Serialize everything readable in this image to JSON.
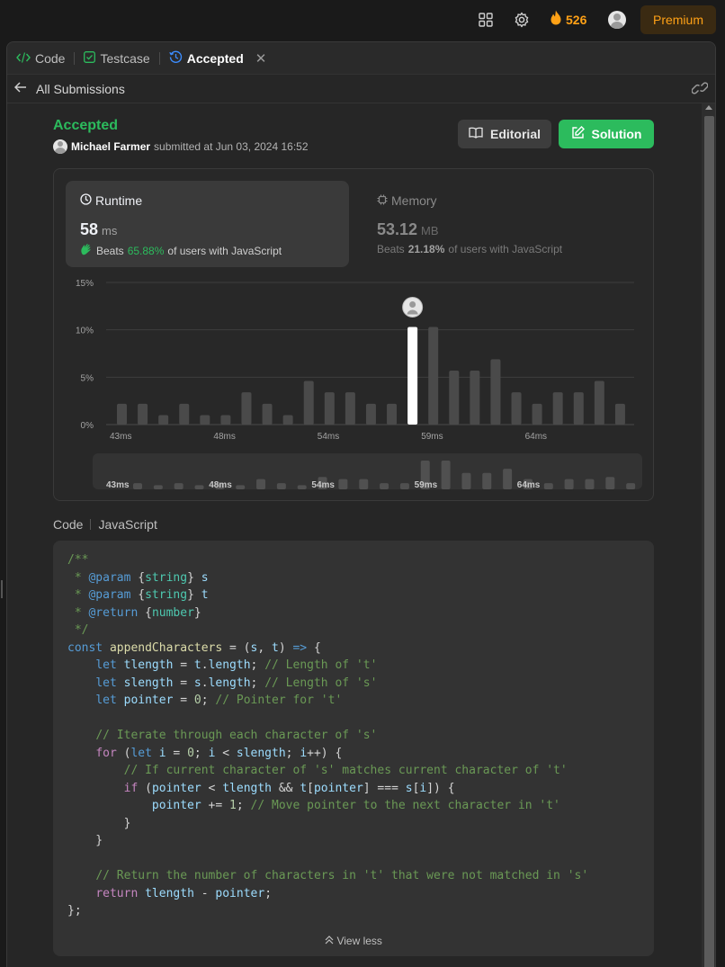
{
  "topbar": {
    "icons": [
      "grid-icon",
      "gear-icon",
      "fire-icon"
    ],
    "streak": "526",
    "premium_label": "Premium"
  },
  "tabs": [
    {
      "label": "Code",
      "icon": "code-icon"
    },
    {
      "label": "Testcase",
      "icon": "checkbox-icon"
    },
    {
      "label": "Accepted",
      "icon": "history-icon"
    }
  ],
  "subbar": {
    "back_label": "All Submissions"
  },
  "submission": {
    "status": "Accepted",
    "user": "Michael Farmer",
    "submitted_text": "submitted at Jun 03, 2024 16:52"
  },
  "buttons": {
    "editorial": "Editorial",
    "solution": "Solution"
  },
  "runtime": {
    "title": "Runtime",
    "value": "58",
    "unit": "ms",
    "beats_prefix": "Beats",
    "beats_pct": "65.88%",
    "beats_suffix": "of users with JavaScript"
  },
  "memory": {
    "title": "Memory",
    "value": "53.12",
    "unit": "MB",
    "beats_prefix": "Beats",
    "beats_pct": "21.18%",
    "beats_suffix": "of users with JavaScript"
  },
  "chart_data": {
    "type": "bar",
    "yticks": [
      "15%",
      "10%",
      "5%",
      "0%"
    ],
    "ylim": [
      0,
      15
    ],
    "xtick_labels": [
      "43ms",
      "48ms",
      "54ms",
      "59ms",
      "64ms"
    ],
    "xtick_bar_index": [
      0,
      5,
      10,
      15,
      20
    ],
    "values": [
      2.2,
      2.2,
      1.0,
      2.2,
      1.0,
      1.0,
      3.4,
      2.2,
      1.0,
      4.6,
      3.4,
      3.4,
      2.2,
      2.2,
      10.3,
      10.3,
      5.7,
      5.7,
      6.9,
      3.4,
      2.2,
      3.4,
      3.4,
      4.6,
      2.2
    ],
    "highlight_index": 14,
    "overview_values": [
      1.5,
      1,
      1.5,
      1,
      1.5,
      1,
      2.5,
      1.5,
      1,
      3,
      2.5,
      2.5,
      1.5,
      1.5,
      7,
      7,
      4,
      4,
      5,
      2.5,
      1.5,
      2.5,
      2.5,
      3,
      1.5
    ]
  },
  "code": {
    "header": "Code",
    "language": "JavaScript",
    "view_less": "View less"
  },
  "colors": {
    "accent_green": "#2cbb5d",
    "premium_orange": "#ffa116"
  }
}
